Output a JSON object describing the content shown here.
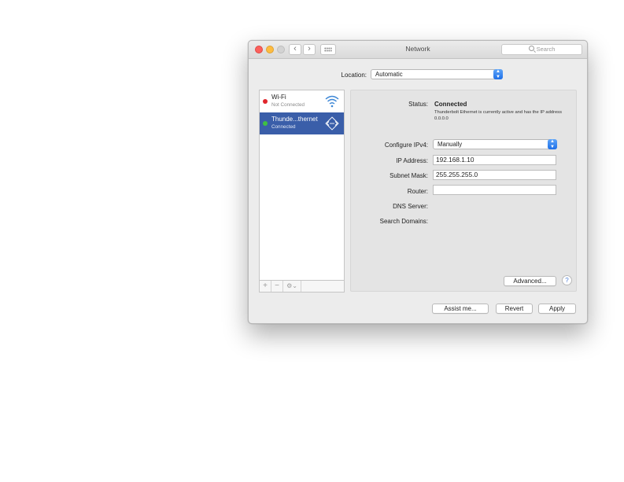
{
  "window": {
    "title": "Network",
    "search_placeholder": "Search"
  },
  "location": {
    "label": "Location:",
    "value": "Automatic"
  },
  "services": [
    {
      "name": "Wi-Fi",
      "status": "Not Connected",
      "dot_color": "#e0262c",
      "icon": "wifi-icon",
      "selected": false
    },
    {
      "name": "Thunde...thernet",
      "status": "Connected",
      "dot_color": "#3fc141",
      "icon": "ethernet-icon",
      "selected": true
    }
  ],
  "list_tools": {
    "add": "+",
    "remove": "−",
    "action": "⚙⌄"
  },
  "detail": {
    "status_label": "Status:",
    "status_value": "Connected",
    "status_desc": "Thunderbolt Ethernet is currently active and has the IP address 0.0.0.0",
    "configure_label": "Configure IPv4:",
    "configure_value": "Manually",
    "ip_label": "IP Address:",
    "ip_value": "192.168.1.10",
    "mask_label": "Subnet Mask:",
    "mask_value": "255.255.255.0",
    "router_label": "Router:",
    "router_value": "",
    "dns_label": "DNS Server:",
    "search_domains_label": "Search Domains:",
    "advanced_label": "Advanced...",
    "help_label": "?"
  },
  "footer": {
    "assist_label": "Assist me...",
    "revert_label": "Revert",
    "apply_label": "Apply"
  },
  "colors": {
    "accent": "#3a5ea9",
    "select_arrow": "#1e6fe8"
  }
}
